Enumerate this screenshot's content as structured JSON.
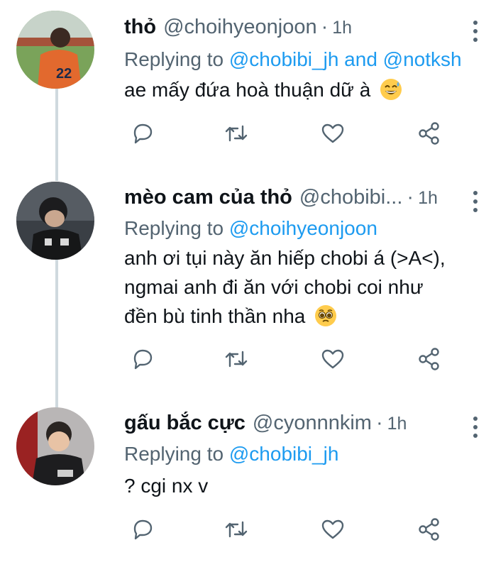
{
  "tweets": [
    {
      "name": "thỏ",
      "handle": "@choihyeonjoon",
      "dot": "·",
      "time": "1h",
      "replying_prefix": "Replying to ",
      "replying_to": "@chobibi_jh and @notksh",
      "text": "ae mấy đứa hoà thuận dữ à",
      "emoji": "sweat-smile-emoji"
    },
    {
      "name": "mèo cam của thỏ",
      "handle": "@chobibi...",
      "dot": "·",
      "time": "1h",
      "replying_prefix": "Replying to ",
      "replying_to": "@choihyeonjoon",
      "text": "anh ơi tụi này ăn hiếp chobi á (>A<), ngmai anh đi ăn với chobi coi như đền bù tinh thần nha",
      "emoji": "pleading-face-emoji"
    },
    {
      "name": "gấu bắc cực",
      "handle": "@cyonnnkim",
      "dot": "·",
      "time": "1h",
      "replying_prefix": "Replying to ",
      "replying_to": "@chobibi_jh",
      "text": "? cgi nx v",
      "emoji": ""
    }
  ],
  "icons": {
    "reply": "reply-icon",
    "retweet": "retweet-icon",
    "like": "heart-icon",
    "share": "share-icon",
    "more": "more-icon"
  },
  "colors": {
    "link": "#1d9bf0",
    "muted": "#536471",
    "text": "#0f1419",
    "thread_line": "#cfd9de"
  }
}
